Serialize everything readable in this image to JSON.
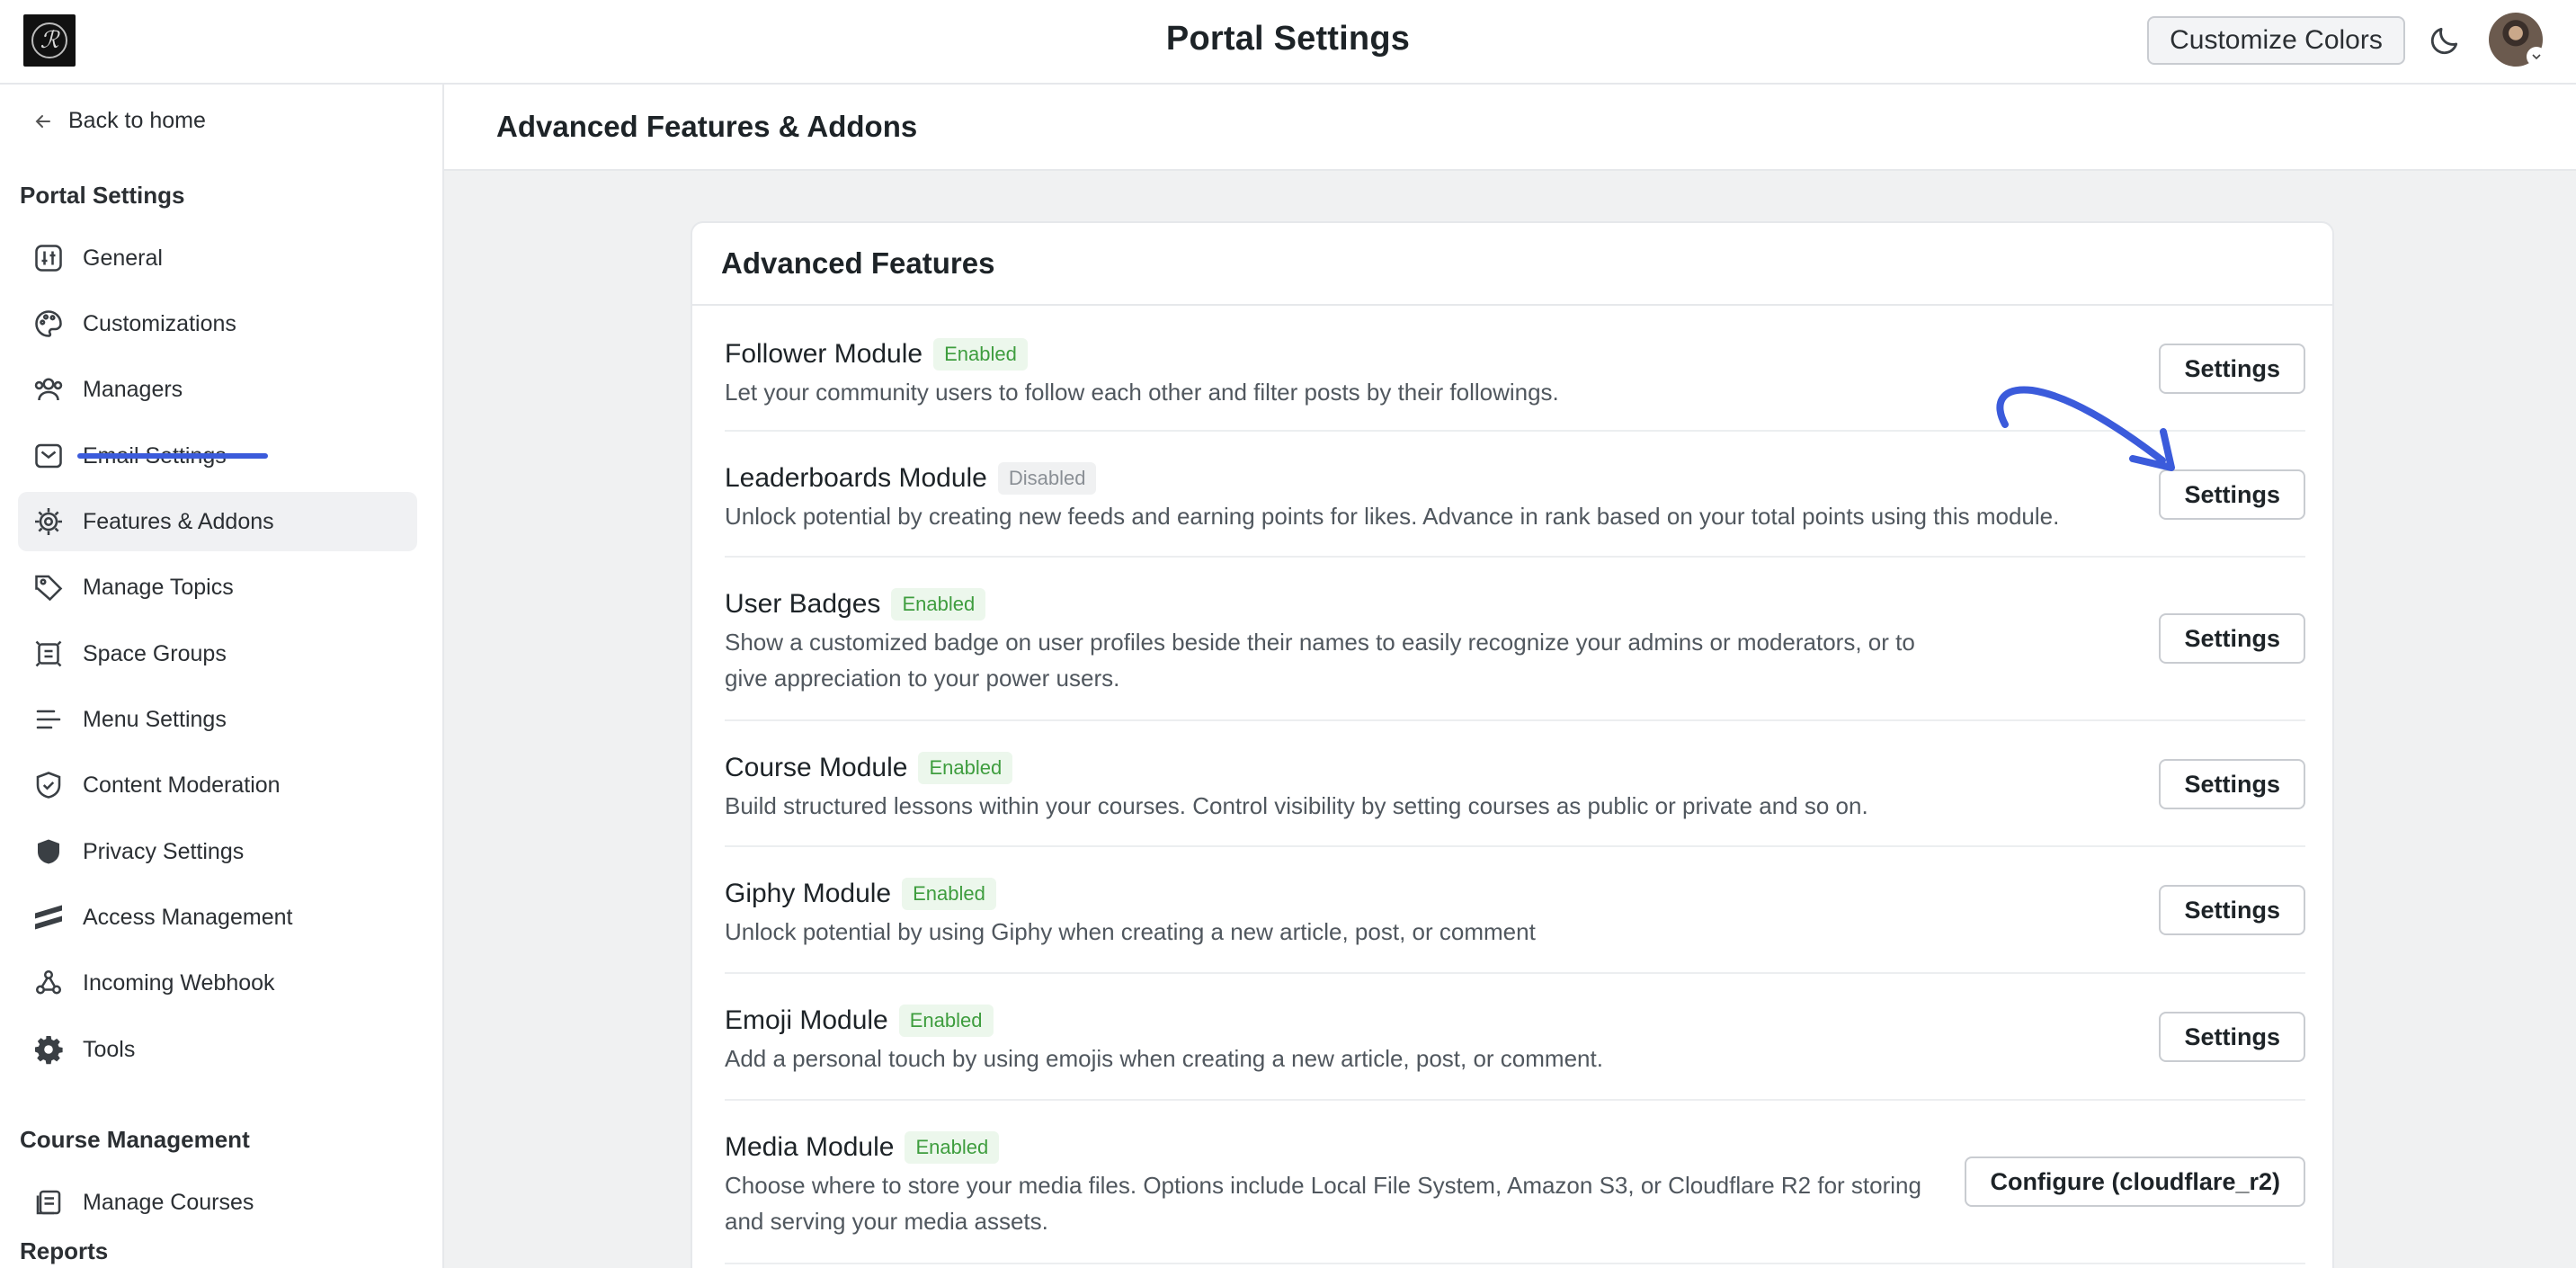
{
  "header": {
    "title": "Portal Settings",
    "customize_label": "Customize Colors"
  },
  "sidebar": {
    "back_label": "Back to home",
    "section_portal": "Portal Settings",
    "items": [
      {
        "label": "General",
        "icon": "general-icon"
      },
      {
        "label": "Customizations",
        "icon": "palette-icon"
      },
      {
        "label": "Managers",
        "icon": "users-icon"
      },
      {
        "label": "Email Settings",
        "icon": "mail-icon"
      },
      {
        "label": "Features & Addons",
        "icon": "cpu-icon",
        "active": true
      },
      {
        "label": "Manage Topics",
        "icon": "tag-icon"
      },
      {
        "label": "Space Groups",
        "icon": "grid-icon"
      },
      {
        "label": "Menu Settings",
        "icon": "menu-icon"
      },
      {
        "label": "Content Moderation",
        "icon": "shield-check-icon"
      },
      {
        "label": "Privacy Settings",
        "icon": "shield-icon"
      },
      {
        "label": "Access Management",
        "icon": "access-icon"
      },
      {
        "label": "Incoming Webhook",
        "icon": "webhook-icon"
      },
      {
        "label": "Tools",
        "icon": "gear-icon"
      }
    ],
    "section_course": "Course Management",
    "course_items": [
      {
        "label": "Manage Courses",
        "icon": "courses-icon"
      }
    ],
    "section_reports": "Reports"
  },
  "main": {
    "title": "Advanced Features & Addons",
    "card_title": "Advanced Features",
    "features": [
      {
        "name": "Follower Module",
        "status": "Enabled",
        "description": "Let your community users to follow each other and filter posts by their followings.",
        "button": "Settings"
      },
      {
        "name": "Leaderboards Module",
        "status": "Disabled",
        "description": "Unlock potential by creating new feeds and earning points for likes. Advance in rank based on your total points using this module.",
        "button": "Settings"
      },
      {
        "name": "User Badges",
        "status": "Enabled",
        "description": "Show a customized badge on user profiles beside their names to easily recognize your admins or moderators, or to give appreciation to your power users.",
        "button": "Settings"
      },
      {
        "name": "Course Module",
        "status": "Enabled",
        "description": "Build structured lessons within your courses. Control visibility by setting courses as public or private and so on.",
        "button": "Settings"
      },
      {
        "name": "Giphy Module",
        "status": "Enabled",
        "description": "Unlock potential by using Giphy when creating a new article, post, or comment",
        "button": "Settings"
      },
      {
        "name": "Emoji Module",
        "status": "Enabled",
        "description": "Add a personal touch by using emojis when creating a new article, post, or comment.",
        "button": "Settings"
      },
      {
        "name": "Media Module",
        "status": "Enabled",
        "description": "Choose where to store your media files. Options include Local File System, Amazon S3, or Cloudflare R2 for storing and serving your media assets.",
        "button": "Configure (cloudflare_r2)"
      }
    ]
  },
  "colors": {
    "accent": "#3b5bdb",
    "enabled_text": "#3e9d3e",
    "enabled_bg": "#ecf7ec",
    "disabled_text": "#8a8f95"
  }
}
